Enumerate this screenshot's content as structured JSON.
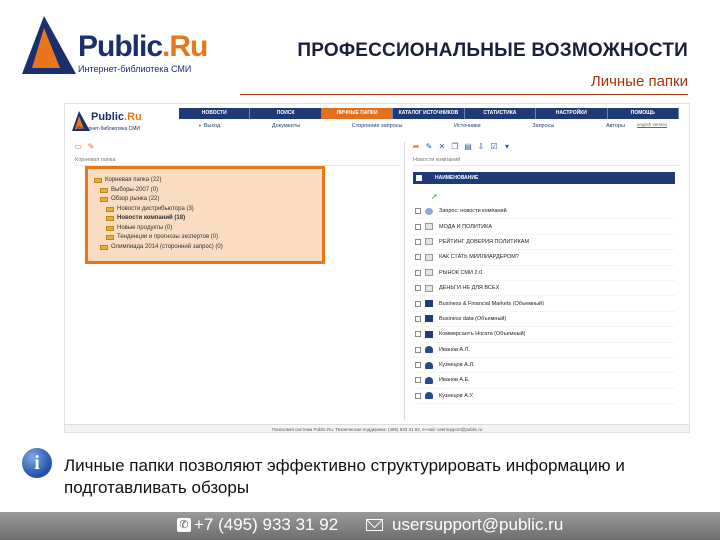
{
  "header": {
    "logo_name_a": "Public",
    "logo_name_b": ".Ru",
    "logo_sub": "Интернет-библиотека СМИ",
    "title": "ПРОФЕССИОНАЛЬНЫЕ ВОЗМОЖНОСТИ",
    "subtitle": "Личные папки"
  },
  "screenshot": {
    "nav": [
      "НОВОСТИ",
      "ПОИСК",
      "ЛИЧНЫЕ ПАПКИ",
      "КАТАЛОГ ИСТОЧНИКОВ",
      "СТАТИСТИКА",
      "НАСТРОЙКИ",
      "ПОМОЩЬ"
    ],
    "nav_active_index": 2,
    "subnav": [
      "Выход",
      "Документы",
      "Сторонние запросы",
      "Источники",
      "Запросы",
      "Авторы"
    ],
    "lang": "english version",
    "left_title": "Корневая папка",
    "tree": [
      {
        "label": "Корневая папка (22)",
        "level": 0
      },
      {
        "label": "Выборы-2007 (0)",
        "level": 1
      },
      {
        "label": "Обзор рынка (22)",
        "level": 1
      },
      {
        "label": "Новости дистрибьютора (3)",
        "level": 2
      },
      {
        "label": "Новости компаний (18)",
        "level": 2
      },
      {
        "label": "Новые продукты (0)",
        "level": 2
      },
      {
        "label": "Тенденции и прогнозы экспертов (0)",
        "level": 2
      },
      {
        "label": "Олимпиада 2014 (сторонний запрос) (0)",
        "level": 1
      }
    ],
    "right_title": "Новости компаний",
    "table_header": "НАИМЕНОВАНИЕ",
    "rows": [
      {
        "label": "Запрос: новости компаний",
        "icon": "globe"
      },
      {
        "label": "МОДА И ПОЛИТИКА",
        "icon": "doc"
      },
      {
        "label": "РЕЙТИНГ ДОВЕРИЯ ПОЛИТИКАМ",
        "icon": "doc"
      },
      {
        "label": "КАК СТАТЬ МИЛЛИАРДЕРОМ?",
        "icon": "doc"
      },
      {
        "label": "РЫНОК СМИ 2.0",
        "icon": "doc"
      },
      {
        "label": "ДЕНЬГИ НЕ ДЛЯ ВСЕХ",
        "icon": "doc"
      },
      {
        "label": "Business & Financial Markets (Объемный)",
        "icon": "book"
      },
      {
        "label": "Business data (Объемный)",
        "icon": "book"
      },
      {
        "label": "Коммерсантъ Ногата (Объемный)",
        "icon": "book"
      },
      {
        "label": "Иванов А.Л.",
        "icon": "person"
      },
      {
        "label": "Кузнецов А.Л.",
        "icon": "person"
      },
      {
        "label": "Иванов А.Е.",
        "icon": "person"
      },
      {
        "label": "Кузнецов А.У.",
        "icon": "person"
      }
    ],
    "footer": "Поисковая система Public.Ru. Техническая поддержка: (495) 933 31 92, e-mail: usersupport@public.ru"
  },
  "info": {
    "text": "Личные папки позволяют эффективно структурировать информацию и подготавливать обзоры"
  },
  "contact": {
    "phone": "+7 (495) 933 31 92",
    "email": "usersupport@public.ru"
  },
  "colors": {
    "brand_navy": "#1e3b77",
    "brand_orange": "#e46f1c",
    "title_accent": "#a8320a"
  }
}
